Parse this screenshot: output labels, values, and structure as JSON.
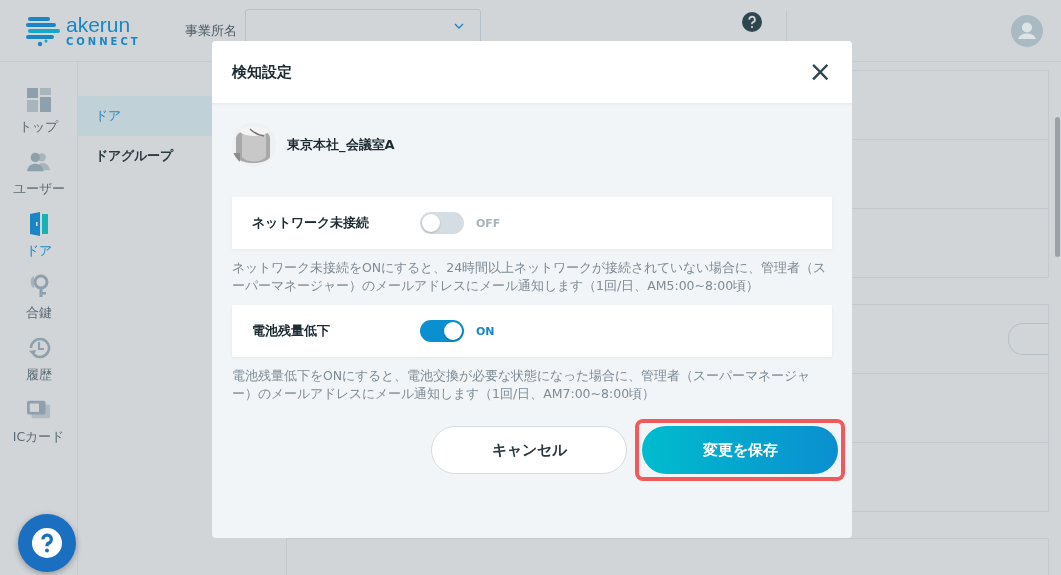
{
  "header": {
    "logo_name": "akerun",
    "logo_sub": "CONNECT",
    "office_label": "事業所名"
  },
  "nav": [
    {
      "label": "トップ",
      "selected": false
    },
    {
      "label": "ユーザー",
      "selected": false
    },
    {
      "label": "ドア",
      "selected": true
    },
    {
      "label": "合鍵",
      "selected": false
    },
    {
      "label": "履歴",
      "selected": false
    },
    {
      "label": "ICカード",
      "selected": false
    }
  ],
  "subnav": [
    {
      "label": "ドア",
      "selected": true
    },
    {
      "label": "ドアグループ",
      "selected": false
    }
  ],
  "dialog": {
    "title": "検知設定",
    "close": "×",
    "device": {
      "name": "東京本社_会議室A"
    },
    "settings": [
      {
        "label": "ネットワーク未接続",
        "on": false,
        "state_text": "OFF",
        "description": "ネットワーク未接続をONにすると、24時間以上ネットワークが接続されていない場合に、管理者（スーパーマネージャー）のメールアドレスにメール通知します（1回/日、AM5:00~8:00頃）"
      },
      {
        "label": "電池残量低下",
        "on": true,
        "state_text": "ON",
        "description": "電池残量低下をONにすると、電池交換が必要な状態になった場合に、管理者（スーパーマネージャー）のメールアドレスにメール通知します（1回/日、AM7:00~8:00頃）"
      }
    ],
    "buttons": [
      {
        "label": "キャンセル",
        "kind": "secondary",
        "highlighted": false
      },
      {
        "label": "変更を保存",
        "kind": "primary",
        "highlighted": true
      }
    ]
  }
}
